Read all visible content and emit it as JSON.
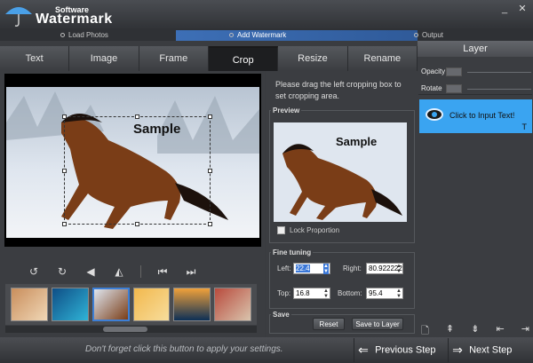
{
  "app": {
    "brand_top": "Software",
    "brand_main": "Watermark"
  },
  "window_controls": {
    "minimize": "_",
    "close": "✕"
  },
  "steps": [
    {
      "label": "Load Photos"
    },
    {
      "label": "Add Watermark"
    },
    {
      "label": "Output"
    }
  ],
  "tabs": [
    {
      "label": "Text"
    },
    {
      "label": "Image"
    },
    {
      "label": "Frame"
    },
    {
      "label": "Crop"
    },
    {
      "label": "Resize"
    },
    {
      "label": "Rename"
    }
  ],
  "preview_canvas": {
    "sample_text": "Sample"
  },
  "crop_panel": {
    "instruction": "Please drag the left cropping box to set cropping area.",
    "preview_title": "Preview",
    "preview_sample_text": "Sample",
    "lock_label": "Lock Proportion",
    "fine_tuning_title": "Fine tuning",
    "left_label": "Left:",
    "left_value": "22.4",
    "right_label": "Right:",
    "right_value": "80.922222",
    "top_label": "Top:",
    "top_value": "16.8",
    "bottom_label": "Bottom:",
    "bottom_value": "95.4",
    "save_title": "Save",
    "reset_label": "Reset",
    "save_to_layer_label": "Save to Layer"
  },
  "layer_panel": {
    "title": "Layer",
    "opacity_label": "Opacity",
    "rotate_label": "Rotate",
    "item_text": "Click to Input Text!",
    "item_type_icon": "T"
  },
  "footer": {
    "hint": "Don't forget click this button to apply your settings.",
    "previous_label": "Previous Step",
    "next_label": "Next Step"
  },
  "colors": {
    "accent_blue": "#3aa4f1",
    "active_step": "#3d6fb6",
    "panel_bg": "#3b3d41"
  }
}
